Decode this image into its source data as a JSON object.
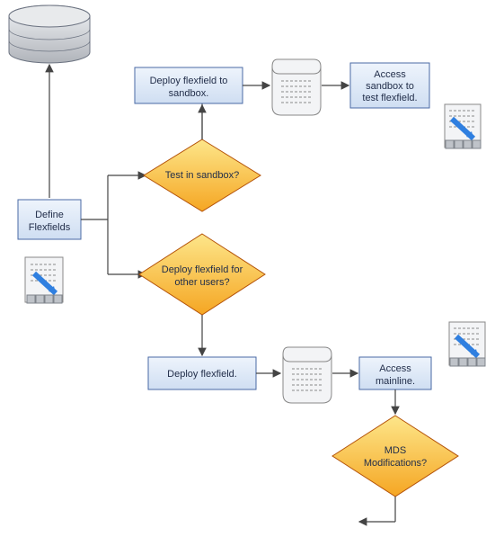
{
  "chart_data": {
    "type": "flowchart",
    "nodes": [
      {
        "id": "db",
        "type": "database",
        "label": ""
      },
      {
        "id": "define",
        "type": "process",
        "label": "Define Flexfields"
      },
      {
        "id": "deploy_sandbox",
        "type": "process",
        "label": "Deploy flexfield to sandbox."
      },
      {
        "id": "access_sandbox",
        "type": "process",
        "label": "Access sandbox to test flexfield."
      },
      {
        "id": "test_sandbox",
        "type": "decision",
        "label": "Test in sandbox?"
      },
      {
        "id": "deploy_other",
        "type": "decision",
        "label": "Deploy flexfield for other users?"
      },
      {
        "id": "deploy",
        "type": "process",
        "label": "Deploy flexfield."
      },
      {
        "id": "access_main",
        "type": "process",
        "label": "Access mainline."
      },
      {
        "id": "mds",
        "type": "decision",
        "label": "MDS Modifications?"
      },
      {
        "id": "doc1",
        "type": "document",
        "label": ""
      },
      {
        "id": "doc2",
        "type": "document",
        "label": ""
      },
      {
        "id": "screen1",
        "type": "screen",
        "label": ""
      },
      {
        "id": "screen2",
        "type": "screen",
        "label": ""
      },
      {
        "id": "screen3",
        "type": "screen",
        "label": ""
      }
    ],
    "edges": [
      [
        "db",
        "define"
      ],
      [
        "define",
        "test_sandbox"
      ],
      [
        "define",
        "deploy_other"
      ],
      [
        "test_sandbox",
        "deploy_sandbox"
      ],
      [
        "deploy_sandbox",
        "doc1"
      ],
      [
        "doc1",
        "access_sandbox"
      ],
      [
        "deploy_other",
        "deploy"
      ],
      [
        "deploy",
        "doc2"
      ],
      [
        "doc2",
        "access_main"
      ],
      [
        "access_main",
        "mds"
      ]
    ]
  },
  "nodes": {
    "define": {
      "l1": "Define",
      "l2": "Flexfields"
    },
    "deploy_sandbox": {
      "l1": "Deploy flexfield to",
      "l2": "sandbox."
    },
    "access_sandbox": {
      "l1": "Access",
      "l2": "sandbox to",
      "l3": "test flexfield."
    },
    "test_sandbox": {
      "l1": "Test in sandbox?"
    },
    "deploy_other": {
      "l1": "Deploy flexfield for",
      "l2": "other users?"
    },
    "deploy": {
      "l1": "Deploy flexfield."
    },
    "access_main": {
      "l1": "Access",
      "l2": "mainline."
    },
    "mds": {
      "l1": "MDS",
      "l2": "Modifications?"
    }
  },
  "colors": {
    "processFill": "#dfe8f6",
    "processStroke": "#4a6aa5",
    "decisionFill": "#fbbf24",
    "decisionFillLight": "#fde68a",
    "decisionStroke": "#b45309",
    "dbFill": "#d1d5db",
    "dbStroke": "#6b7280",
    "arrow": "#444444"
  }
}
